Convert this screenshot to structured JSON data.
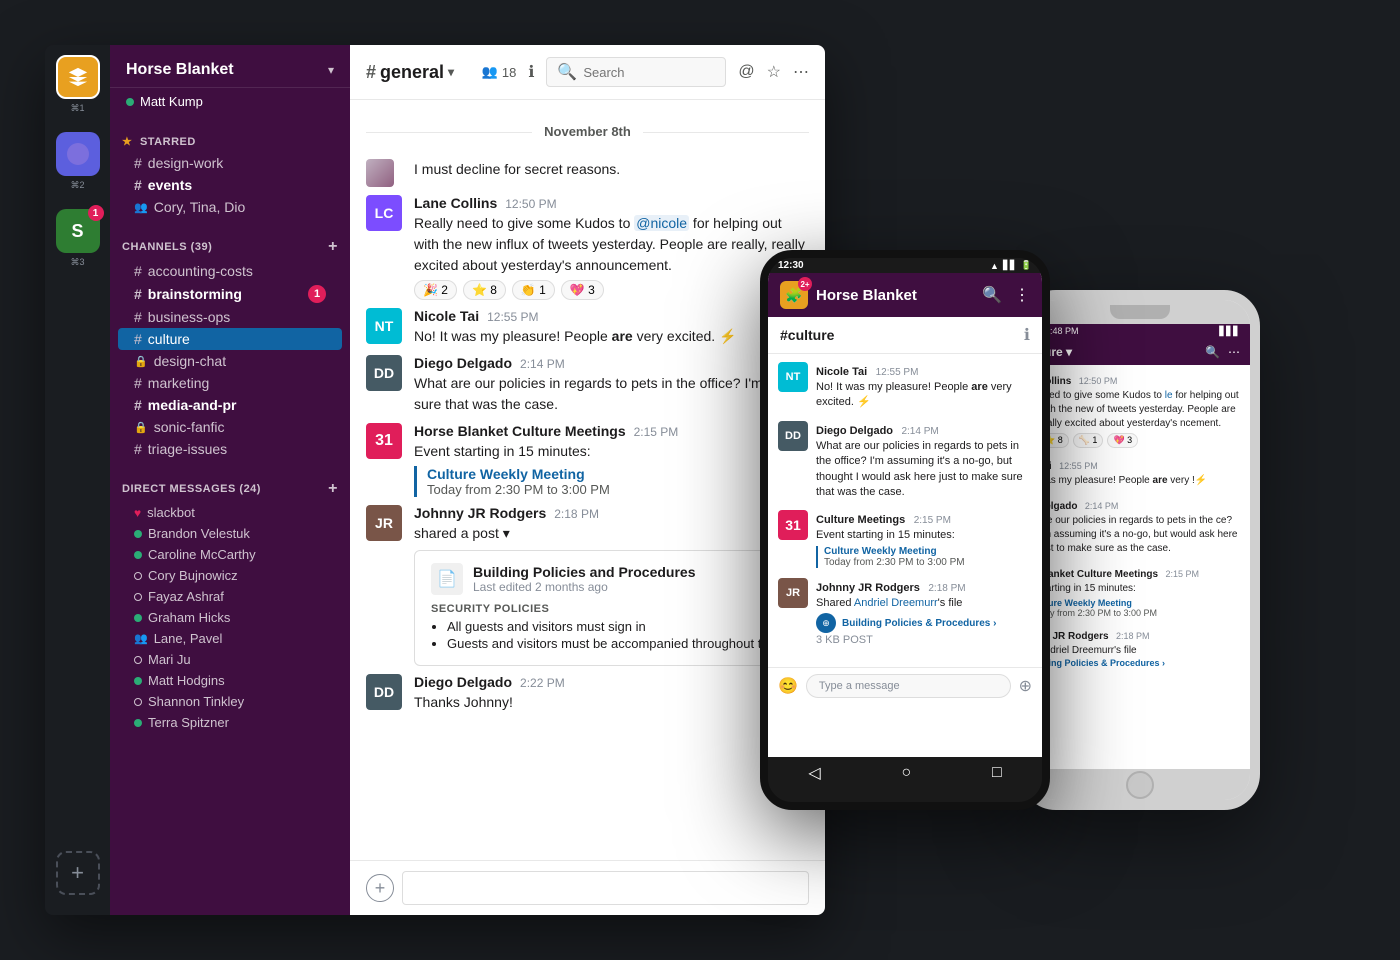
{
  "app": {
    "title": "Horse Blanket",
    "workspace": {
      "name": "Horse Blanket",
      "user": "Matt Kump",
      "user_status": "online"
    },
    "workspaces": [
      {
        "id": "ws1",
        "icon": "🧩",
        "shortcut": "⌘1",
        "color": "#e8a020"
      },
      {
        "id": "ws2",
        "icon": "⬤",
        "shortcut": "⌘2",
        "color": "#5c5fde"
      },
      {
        "id": "ws3",
        "icon": "S",
        "shortcut": "⌘3",
        "color": "#2e7d32",
        "badge": "1"
      }
    ],
    "starred_label": "STARRED",
    "starred_channels": [
      {
        "id": "design-work",
        "name": "design-work",
        "type": "channel"
      },
      {
        "id": "events",
        "name": "events",
        "type": "channel",
        "bold": true
      },
      {
        "id": "events-members",
        "name": "Cory, Tina, Dio",
        "type": "dm-group"
      }
    ],
    "channels_label": "CHANNELS",
    "channels_count": "39",
    "channels": [
      {
        "id": "accounting-costs",
        "name": "accounting-costs",
        "type": "channel"
      },
      {
        "id": "brainstorming",
        "name": "brainstorming",
        "type": "channel",
        "bold": true,
        "badge": "1"
      },
      {
        "id": "business-ops",
        "name": "business-ops",
        "type": "channel"
      },
      {
        "id": "culture",
        "name": "culture",
        "type": "channel",
        "active": true
      },
      {
        "id": "design-chat",
        "name": "design-chat",
        "type": "private"
      },
      {
        "id": "marketing",
        "name": "marketing",
        "type": "channel"
      },
      {
        "id": "media-and-pr",
        "name": "media-and-pr",
        "type": "channel",
        "bold": true
      },
      {
        "id": "sonic-fanfic",
        "name": "sonic-fanfic",
        "type": "private"
      },
      {
        "id": "triage-issues",
        "name": "triage-issues",
        "type": "channel"
      }
    ],
    "dm_label": "DIRECT MESSAGES",
    "dm_count": "24",
    "direct_messages": [
      {
        "id": "slackbot",
        "name": "slackbot",
        "type": "heart",
        "status": "online"
      },
      {
        "id": "brandon",
        "name": "Brandon Velestuk",
        "status": "online"
      },
      {
        "id": "caroline",
        "name": "Caroline McCarthy",
        "status": "online"
      },
      {
        "id": "cory",
        "name": "Cory Bujnowicz",
        "status": "offline"
      },
      {
        "id": "fayaz",
        "name": "Fayaz Ashraf",
        "status": "offline"
      },
      {
        "id": "graham",
        "name": "Graham Hicks",
        "status": "online"
      },
      {
        "id": "lane-pavel",
        "name": "Lane, Pavel",
        "type": "group",
        "status": "online"
      },
      {
        "id": "mari",
        "name": "Mari Ju",
        "status": "offline"
      },
      {
        "id": "matt",
        "name": "Matt Hodgins",
        "status": "online"
      },
      {
        "id": "shannon",
        "name": "Shannon Tinkley",
        "status": "offline"
      },
      {
        "id": "terra",
        "name": "Terra Spitzner",
        "status": "online"
      }
    ]
  },
  "channel": {
    "name": "general",
    "member_count": "18",
    "date_divider": "November 8th",
    "search_placeholder": "Search"
  },
  "messages": [
    {
      "id": "msg0",
      "author": "",
      "time": "",
      "avatar_color": "#ddd",
      "text": "I must decline for secret reasons.",
      "continuation": true
    },
    {
      "id": "msg1",
      "author": "Lane Collins",
      "time": "12:50 PM",
      "avatar_color": "#7c4dff",
      "avatar_initials": "LC",
      "text": "Really need to give some Kudos to @nicole for helping out with the new influx of tweets yesterday. People are really, really excited about yesterday's announcement.",
      "reactions": [
        {
          "emoji": "🎉",
          "count": "2"
        },
        {
          "emoji": "⭐",
          "count": "8"
        },
        {
          "emoji": "👏",
          "count": "1"
        },
        {
          "emoji": "💖",
          "count": "3"
        }
      ]
    },
    {
      "id": "msg2",
      "author": "Nicole Tai",
      "time": "12:55 PM",
      "avatar_color": "#00bcd4",
      "avatar_initials": "NT",
      "text": "No! It was my pleasure! People are very excited. ⚡"
    },
    {
      "id": "msg3",
      "author": "Diego Delgado",
      "time": "2:14 PM",
      "avatar_color": "#455a64",
      "avatar_initials": "DD",
      "text": "What are our policies in regards to pets in the office? I'm assu... sure that was the case."
    },
    {
      "id": "msg4",
      "author": "Horse Blanket Culture Meetings",
      "time": "2:15 PM",
      "avatar_color": "#e01e5a",
      "avatar_type": "calendar",
      "calendar_day": "31",
      "text": "Event starting in 15 minutes:",
      "event": {
        "title": "Culture Weekly Meeting",
        "time": "Today from 2:30 PM to 3:00 PM"
      }
    },
    {
      "id": "msg5",
      "author": "Johnny JR Rodgers",
      "time": "2:18 PM",
      "avatar_color": "#795548",
      "avatar_initials": "JR",
      "text": "shared a post",
      "shared_post": {
        "title": "Building Policies and Procedures",
        "subtitle": "Last edited 2 months ago",
        "section": "SECURITY POLICIES",
        "bullets": [
          "All guests and visitors must sign in",
          "Guests and visitors must be accompanied throughout the..."
        ]
      }
    },
    {
      "id": "msg6",
      "author": "Diego Delgado",
      "time": "2:22 PM",
      "avatar_color": "#455a64",
      "avatar_initials": "DD",
      "text": "Thanks Johnny!"
    }
  ],
  "mobile": {
    "android": {
      "time": "12:30",
      "workspace_name": "Horse Blanket",
      "workspace_badge": "2+",
      "channel": "#culture",
      "messages": [
        {
          "author": "Nicole Tai",
          "time": "12:55 PM",
          "avatar_color": "#00bcd4",
          "initials": "NT",
          "text": "No! It was my pleasure! People are very excited. ⚡",
          "bold_word": "are"
        },
        {
          "author": "Diego Delgado",
          "time": "2:14 PM",
          "avatar_color": "#455a64",
          "initials": "DD",
          "text": "What are our policies in regards to pets in the office? I'm assuming it's a no-go, but thought I would ask here just to make sure that was the case."
        },
        {
          "author": "Culture Meetings",
          "time": "2:15 PM",
          "type": "calendar",
          "calendar_day": "31",
          "text": "Event starting in 15 minutes:",
          "event_title": "Culture Weekly Meeting",
          "event_time": "Today from 2:30 PM to 3:00 PM"
        },
        {
          "author": "Johnny JR Rodgers",
          "time": "2:18 PM",
          "avatar_color": "#795548",
          "initials": "JR",
          "text": "Shared Andriel Dreemurr's file",
          "shared_title": "Building Policies & Procedures",
          "shared_size": "3 KB POST"
        }
      ],
      "input_placeholder": "Type a message"
    },
    "iphone": {
      "channel": "ture",
      "header_label": "ture ▾",
      "messages": [
        {
          "author": "Collins",
          "time": "12:50 PM",
          "text": "need to give some Kudos to le for helping out with the new of tweets yesterday. People are really excited about yesterday's ncement.",
          "reactions": [
            "⭐ 8",
            "🦴 1",
            "💖 3"
          ]
        },
        {
          "author": "Tai",
          "time": "12:55 PM",
          "text": "was my pleasure! People are very !⚡"
        },
        {
          "author": "Delgado",
          "time": "2:14 PM",
          "text": "are our policies in regards to pets in the ce? I'm assuming it's a no-go, but would ask here just to make sure as the case."
        },
        {
          "author": "Blanket Culture Meetings",
          "time": "2:15 PM",
          "type": "calendar",
          "calendar_day": "31",
          "text": "starting in 15 minutes:",
          "event_title": "ture Weekly Meeting",
          "event_time": "ay from 2:30 PM to 3:00 PM"
        },
        {
          "author": "by JR Rodgers",
          "time": "2:18 PM",
          "text": "Andriel Dreemurr's file",
          "shared_title": "ilding Policies & Procedures ›"
        }
      ]
    }
  }
}
